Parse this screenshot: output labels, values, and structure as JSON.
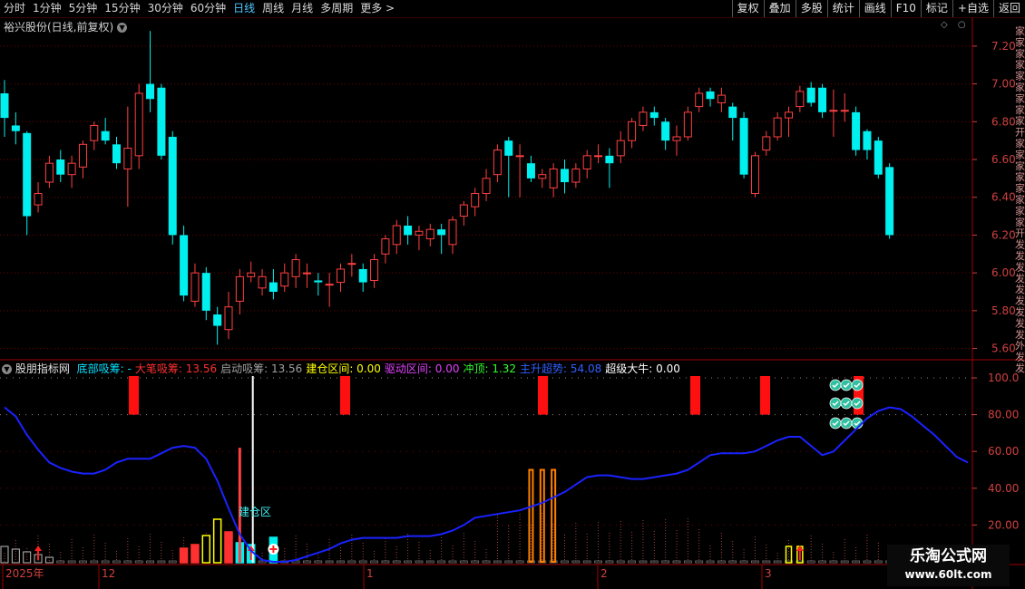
{
  "toolbar": {
    "periods": [
      "分时",
      "1分钟",
      "5分钟",
      "15分钟",
      "30分钟",
      "60分钟",
      "日线",
      "周线",
      "月线",
      "多周期",
      "更多"
    ],
    "active_period": "日线",
    "more_arrow": ">",
    "buttons": [
      "复权",
      "叠加",
      "多股",
      "统计",
      "画线",
      "F10",
      "标记",
      "+自选",
      "返回"
    ]
  },
  "main_panel": {
    "title": "裕兴股份(日线,前复权)",
    "price_ticks": [
      "7.20",
      "7.00",
      "6.80",
      "6.60",
      "6.40",
      "6.20",
      "6.00",
      "5.80",
      "5.60"
    ],
    "side_chars": "家家家家家家家家家开家家家家家家家家开发发发发发发发发发外发发发加发发发发发"
  },
  "indicator_panel": {
    "name": "股朋指标网",
    "fields": [
      {
        "label": "底部吸筹:",
        "value": "-",
        "color": "#00e0ff"
      },
      {
        "label": "大笔吸筹:",
        "value": "13.56",
        "color": "#ff3030"
      },
      {
        "label": "启动吸筹:",
        "value": "13.56",
        "color": "#a0a0a0"
      },
      {
        "label": "建仓区间:",
        "value": "0.00",
        "color": "#ffff00"
      },
      {
        "label": "驱动区间:",
        "value": "0.00",
        "color": "#e040ff"
      },
      {
        "label": "冲顶:",
        "value": "1.32",
        "color": "#30ff30"
      },
      {
        "label": "主升超势:",
        "value": "54.08",
        "color": "#3060ff"
      },
      {
        "label": "超级大牛:",
        "value": "0.00",
        "color": "#ffffff"
      }
    ],
    "ticks": [
      "100.0",
      "80.00",
      "60.00",
      "40.00",
      "20.00"
    ],
    "annotation": "建仓区"
  },
  "date_axis": {
    "labels": [
      "2025年",
      "12",
      "1",
      "2",
      "3"
    ]
  },
  "watermark": {
    "line1": "乐淘公式网",
    "line2": "www.60lt.com"
  },
  "colors": {
    "up": "#ff4040",
    "down": "#00f0f0",
    "grid": "#7a0000",
    "axis": "#d04040",
    "line": "#1a22ff"
  },
  "chart_data": {
    "type": "candlestick",
    "price_range": [
      5.55,
      7.3
    ],
    "candles": [
      [
        6.95,
        6.82,
        7.02,
        6.72
      ],
      [
        6.78,
        6.75,
        6.85,
        6.68
      ],
      [
        6.74,
        6.3,
        6.75,
        6.2
      ],
      [
        6.36,
        6.42,
        6.48,
        6.32
      ],
      [
        6.48,
        6.58,
        6.62,
        6.45
      ],
      [
        6.6,
        6.52,
        6.65,
        6.48
      ],
      [
        6.52,
        6.58,
        6.62,
        6.45
      ],
      [
        6.56,
        6.68,
        6.7,
        6.5
      ],
      [
        6.7,
        6.78,
        6.8,
        6.65
      ],
      [
        6.75,
        6.7,
        6.82,
        6.68
      ],
      [
        6.68,
        6.58,
        6.72,
        6.55
      ],
      [
        6.55,
        6.66,
        6.88,
        6.35
      ],
      [
        6.62,
        6.95,
        7.0,
        6.55
      ],
      [
        7.0,
        6.92,
        7.28,
        6.85
      ],
      [
        6.98,
        6.62,
        7.0,
        6.6
      ],
      [
        6.72,
        6.2,
        6.75,
        6.15
      ],
      [
        6.2,
        5.88,
        6.25,
        5.85
      ],
      [
        5.85,
        6.0,
        6.05,
        5.82
      ],
      [
        6.0,
        5.8,
        6.03,
        5.75
      ],
      [
        5.78,
        5.72,
        5.82,
        5.62
      ],
      [
        5.7,
        5.82,
        5.9,
        5.65
      ],
      [
        5.85,
        5.98,
        6.02,
        5.78
      ],
      [
        5.98,
        6.0,
        6.06,
        5.95
      ],
      [
        5.92,
        5.98,
        6.02,
        5.88
      ],
      [
        5.95,
        5.9,
        6.02,
        5.86
      ],
      [
        5.93,
        6.0,
        6.05,
        5.9
      ],
      [
        5.98,
        6.07,
        6.1,
        5.92
      ],
      [
        6.0,
        6.0,
        6.05,
        5.92
      ],
      [
        5.96,
        5.95,
        6.0,
        5.88
      ],
      [
        5.94,
        5.94,
        6.0,
        5.82
      ],
      [
        5.95,
        6.02,
        6.05,
        5.9
      ],
      [
        6.05,
        6.05,
        6.1,
        5.98
      ],
      [
        6.02,
        5.95,
        6.05,
        5.9
      ],
      [
        5.96,
        6.07,
        6.1,
        5.92
      ],
      [
        6.1,
        6.18,
        6.2,
        6.05
      ],
      [
        6.15,
        6.25,
        6.28,
        6.1
      ],
      [
        6.25,
        6.2,
        6.3,
        6.15
      ],
      [
        6.2,
        6.22,
        6.25,
        6.12
      ],
      [
        6.18,
        6.23,
        6.26,
        6.14
      ],
      [
        6.23,
        6.2,
        6.26,
        6.1
      ],
      [
        6.15,
        6.28,
        6.3,
        6.1
      ],
      [
        6.3,
        6.36,
        6.38,
        6.25
      ],
      [
        6.35,
        6.42,
        6.45,
        6.3
      ],
      [
        6.42,
        6.5,
        6.55,
        6.38
      ],
      [
        6.52,
        6.65,
        6.68,
        6.48
      ],
      [
        6.7,
        6.62,
        6.72,
        6.4
      ],
      [
        6.62,
        6.62,
        6.68,
        6.4
      ],
      [
        6.58,
        6.5,
        6.62,
        6.48
      ],
      [
        6.5,
        6.52,
        6.55,
        6.45
      ],
      [
        6.45,
        6.55,
        6.58,
        6.4
      ],
      [
        6.55,
        6.48,
        6.6,
        6.42
      ],
      [
        6.48,
        6.55,
        6.58,
        6.45
      ],
      [
        6.55,
        6.62,
        6.65,
        6.5
      ],
      [
        6.62,
        6.62,
        6.68,
        6.58
      ],
      [
        6.62,
        6.58,
        6.66,
        6.45
      ],
      [
        6.62,
        6.7,
        6.75,
        6.58
      ],
      [
        6.7,
        6.8,
        6.82,
        6.66
      ],
      [
        6.78,
        6.85,
        6.88,
        6.75
      ],
      [
        6.85,
        6.82,
        6.88,
        6.78
      ],
      [
        6.8,
        6.7,
        6.82,
        6.65
      ],
      [
        6.7,
        6.72,
        6.78,
        6.62
      ],
      [
        6.72,
        6.85,
        6.88,
        6.7
      ],
      [
        6.88,
        6.95,
        6.98,
        6.85
      ],
      [
        6.96,
        6.92,
        6.98,
        6.88
      ],
      [
        6.9,
        6.94,
        6.98,
        6.85
      ],
      [
        6.88,
        6.82,
        6.9,
        6.7
      ],
      [
        6.82,
        6.52,
        6.85,
        6.5
      ],
      [
        6.42,
        6.62,
        6.64,
        6.4
      ],
      [
        6.65,
        6.72,
        6.75,
        6.62
      ],
      [
        6.72,
        6.82,
        6.85,
        6.7
      ],
      [
        6.82,
        6.85,
        6.88,
        6.72
      ],
      [
        6.88,
        6.96,
        6.99,
        6.85
      ],
      [
        6.98,
        6.9,
        7.01,
        6.88
      ],
      [
        6.98,
        6.85,
        7.0,
        6.82
      ],
      [
        6.86,
        6.86,
        6.97,
        6.72
      ],
      [
        6.86,
        6.86,
        6.95,
        6.8
      ],
      [
        6.85,
        6.65,
        6.88,
        6.62
      ],
      [
        6.75,
        6.65,
        6.76,
        6.6
      ],
      [
        6.7,
        6.52,
        6.72,
        6.5
      ],
      [
        6.56,
        6.2,
        6.58,
        6.18
      ]
    ],
    "line_values": [
      84,
      79,
      69,
      61,
      54,
      51,
      49,
      48,
      48,
      50,
      54,
      56,
      56,
      56,
      59,
      62,
      63,
      62,
      56,
      44,
      29,
      15,
      6,
      1,
      0,
      0,
      1,
      3,
      5,
      7,
      10,
      12,
      13,
      13,
      13,
      13,
      14,
      14,
      14,
      15,
      17,
      20,
      24,
      25,
      26,
      27,
      28,
      30,
      32,
      35,
      38,
      42,
      46,
      47,
      47,
      46,
      45,
      45,
      46,
      47,
      48,
      50,
      54,
      58,
      59,
      59,
      59,
      60,
      63,
      66,
      68,
      68,
      63,
      58,
      60,
      66,
      72,
      78,
      82,
      84,
      83,
      79,
      74,
      69,
      63,
      57,
      54
    ],
    "red_blocks_count": 6,
    "kline_highlight_bars": [
      19,
      20,
      21,
      22
    ]
  }
}
